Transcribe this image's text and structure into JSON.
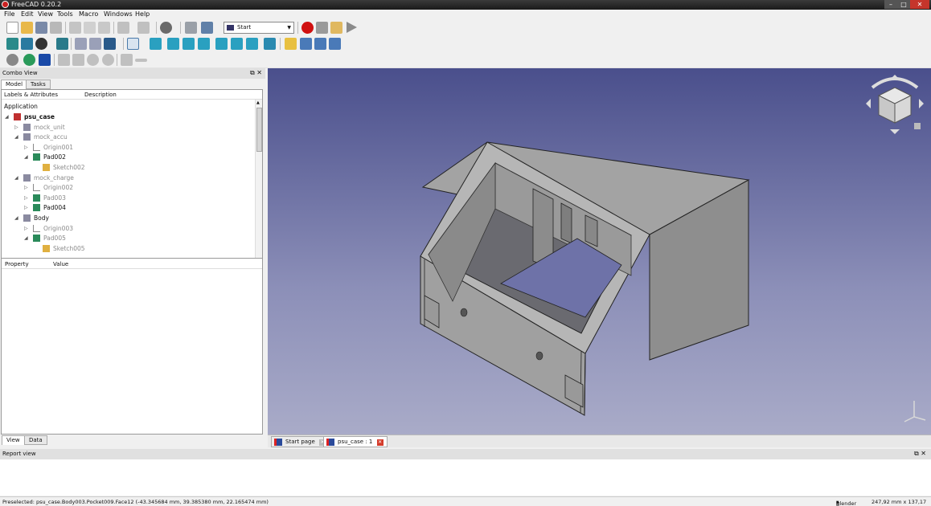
{
  "window": {
    "title": "FreeCAD 0.20.2",
    "controls": {
      "minimize": "–",
      "maximize": "□",
      "close": "✕"
    }
  },
  "menu": [
    "File",
    "Edit",
    "View",
    "Tools",
    "Macro",
    "Windows",
    "Help"
  ],
  "toolbar": {
    "workbench": "Start"
  },
  "combo": {
    "title": "Combo View",
    "tabs": [
      "Model",
      "Tasks"
    ],
    "tree_columns": [
      "Labels & Attributes",
      "Description"
    ],
    "root_label": "Application",
    "tree": [
      {
        "label": "psu_case",
        "state": "bold",
        "expanded": true,
        "icon": "part-icon"
      },
      {
        "label": "mock_unit",
        "state": "dim",
        "expanded": false,
        "icon": "body-icon"
      },
      {
        "label": "mock_accu",
        "state": "dim",
        "expanded": true,
        "icon": "body-icon"
      },
      {
        "label": "Origin001",
        "state": "dim",
        "expanded": false,
        "icon": "origin-icon"
      },
      {
        "label": "Pad002",
        "state": "normal",
        "expanded": true,
        "icon": "pad-icon"
      },
      {
        "label": "Sketch002",
        "state": "dim",
        "expanded": null,
        "icon": "sketch-icon"
      },
      {
        "label": "mock_charge",
        "state": "dim",
        "expanded": true,
        "icon": "body-icon"
      },
      {
        "label": "Origin002",
        "state": "dim",
        "expanded": false,
        "icon": "origin-icon"
      },
      {
        "label": "Pad003",
        "state": "dim",
        "expanded": false,
        "icon": "pad-icon"
      },
      {
        "label": "Pad004",
        "state": "normal",
        "expanded": false,
        "icon": "pad-icon"
      },
      {
        "label": "Body",
        "state": "normal",
        "expanded": true,
        "icon": "body-icon"
      },
      {
        "label": "Origin003",
        "state": "dim",
        "expanded": false,
        "icon": "origin-icon"
      },
      {
        "label": "Pad005",
        "state": "dim",
        "expanded": true,
        "icon": "pad-icon"
      },
      {
        "label": "Sketch005",
        "state": "dim",
        "expanded": null,
        "icon": "sketch-icon"
      }
    ],
    "property_columns": [
      "Property",
      "Value"
    ],
    "bottom_tabs": [
      "View",
      "Data"
    ]
  },
  "view_tabs": [
    {
      "label": "Start page",
      "active": false
    },
    {
      "label": "psu_case : 1",
      "active": true
    }
  ],
  "report": {
    "title": "Report view"
  },
  "status": {
    "message": "Preselected: psu_case.Body003.Pocket009.Face12 (-43.345684 mm, 39.385380 mm, 22.165474 mm)",
    "nav_style": "Blender",
    "dimensions": "247,92 mm x 137,17 mm"
  },
  "colors": {
    "view_bg_top": "#4a4f8c",
    "view_bg_bottom": "#a9abc8",
    "model_face": "#a8a8a8"
  }
}
